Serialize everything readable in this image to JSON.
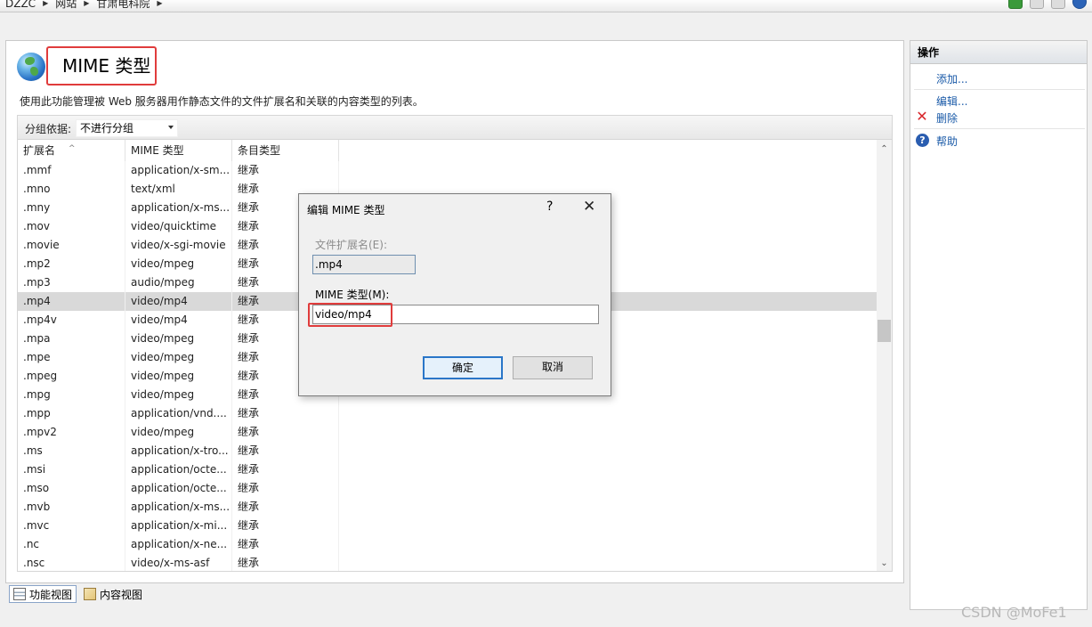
{
  "breadcrumb": {
    "items": [
      "DZZC",
      "网站",
      "甘肃电科院"
    ]
  },
  "main": {
    "title": "MIME 类型",
    "description": "使用此功能管理被 Web 服务器用作静态文件的文件扩展名和关联的内容类型的列表。",
    "group_by": {
      "label": "分组依据:",
      "value": "不进行分组"
    },
    "columns": [
      "扩展名",
      "MIME 类型",
      "条目类型"
    ],
    "rows": [
      {
        "ext": ".mmf",
        "mime": "application/x-sm...",
        "type": "继承"
      },
      {
        "ext": ".mno",
        "mime": "text/xml",
        "type": "继承"
      },
      {
        "ext": ".mny",
        "mime": "application/x-ms...",
        "type": "继承"
      },
      {
        "ext": ".mov",
        "mime": "video/quicktime",
        "type": "继承"
      },
      {
        "ext": ".movie",
        "mime": "video/x-sgi-movie",
        "type": "继承"
      },
      {
        "ext": ".mp2",
        "mime": "video/mpeg",
        "type": "继承"
      },
      {
        "ext": ".mp3",
        "mime": "audio/mpeg",
        "type": "继承"
      },
      {
        "ext": ".mp4",
        "mime": "video/mp4",
        "type": "继承",
        "selected": true
      },
      {
        "ext": ".mp4v",
        "mime": "video/mp4",
        "type": "继承"
      },
      {
        "ext": ".mpa",
        "mime": "video/mpeg",
        "type": "继承"
      },
      {
        "ext": ".mpe",
        "mime": "video/mpeg",
        "type": "继承"
      },
      {
        "ext": ".mpeg",
        "mime": "video/mpeg",
        "type": "继承"
      },
      {
        "ext": ".mpg",
        "mime": "video/mpeg",
        "type": "继承"
      },
      {
        "ext": ".mpp",
        "mime": "application/vnd....",
        "type": "继承"
      },
      {
        "ext": ".mpv2",
        "mime": "video/mpeg",
        "type": "继承"
      },
      {
        "ext": ".ms",
        "mime": "application/x-tro...",
        "type": "继承"
      },
      {
        "ext": ".msi",
        "mime": "application/octe...",
        "type": "继承"
      },
      {
        "ext": ".mso",
        "mime": "application/octe...",
        "type": "继承"
      },
      {
        "ext": ".mvb",
        "mime": "application/x-ms...",
        "type": "继承"
      },
      {
        "ext": ".mvc",
        "mime": "application/x-mi...",
        "type": "继承"
      },
      {
        "ext": ".nc",
        "mime": "application/x-ne...",
        "type": "继承"
      },
      {
        "ext": ".nsc",
        "mime": "video/x-ms-asf",
        "type": "继承"
      }
    ]
  },
  "view_tabs": {
    "features": "功能视图",
    "content": "内容视图"
  },
  "actions": {
    "title": "操作",
    "add": "添加...",
    "edit": "编辑...",
    "delete": "删除",
    "help": "帮助"
  },
  "dialog": {
    "title": "编辑 MIME 类型",
    "help_glyph": "?",
    "close_glyph": "✕",
    "ext_label": "文件扩展名(E):",
    "ext_value": ".mp4",
    "mime_label": "MIME 类型(M):",
    "mime_value": "video/mp4",
    "ok": "确定",
    "cancel": "取消"
  },
  "watermark": "CSDN @MoFe1",
  "colors": {
    "highlight_box": "#e03c3c",
    "link": "#1a5aa8",
    "ok_border": "#2a76c8"
  }
}
